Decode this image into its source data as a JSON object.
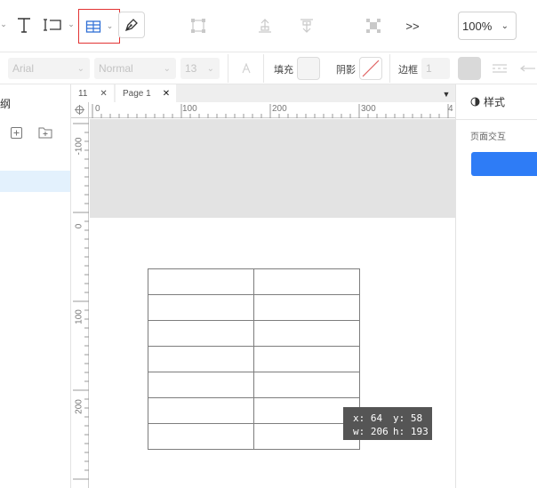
{
  "toolbar": {
    "zoom_value": "100%",
    "more_label": ">>"
  },
  "format_bar": {
    "font_family": "Arial",
    "font_weight": "Normal",
    "font_size": "13",
    "fill_label": "填充",
    "shadow_label": "阴影",
    "border_label": "边框",
    "border_width": "1"
  },
  "left_panel": {
    "title": "纲"
  },
  "tabs": [
    {
      "label": "11"
    },
    {
      "label": "Page 1"
    }
  ],
  "ruler": {
    "h_labels": [
      "0",
      "100",
      "200",
      "300",
      "4"
    ],
    "v_labels": [
      "-100",
      "0",
      "100",
      "200"
    ]
  },
  "canvas": {
    "table": {
      "rows": 7,
      "cols": 2
    },
    "tooltip": {
      "x": "x: 64",
      "y": "y: 58",
      "w": "w: 206",
      "h": "h: 193"
    }
  },
  "right_panel": {
    "tab_style": "样式",
    "page_interaction": "页面交互"
  }
}
